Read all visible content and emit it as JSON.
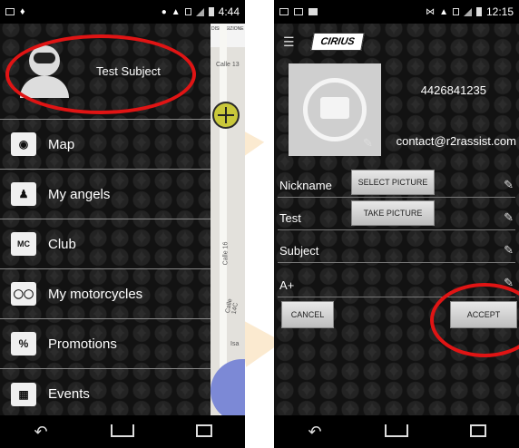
{
  "left_screen": {
    "status_bar": {
      "time": "4:44"
    },
    "profile": {
      "name": "Test Subject"
    },
    "menu": [
      {
        "label": "Map",
        "icon": "map-pin-icon"
      },
      {
        "label": "My angels",
        "icon": "people-icon"
      },
      {
        "label": "Club",
        "icon": "club-house-icon"
      },
      {
        "label": "My motorcycles",
        "icon": "motorcycle-icon"
      },
      {
        "label": "Promotions",
        "icon": "price-tag-icon"
      },
      {
        "label": "Events",
        "icon": "calendar-icon"
      }
    ],
    "map": {
      "top_text": "DISPOSIZIONE",
      "labels": [
        "Calle 13",
        "Calle 16",
        "Calle 14C",
        "Isa"
      ]
    }
  },
  "right_screen": {
    "status_bar": {
      "time": "12:15"
    },
    "logo_text": "CIRIUS",
    "phone": "4426841235",
    "email": "contact@r2rassist.com",
    "fields": {
      "nickname": "Nickname",
      "first_name": "Test",
      "last_name": "Subject",
      "blood_type": "A+"
    },
    "buttons": {
      "select_picture": "SELECT PICTURE",
      "take_picture": "TAKE PICTURE",
      "cancel": "CANCEL",
      "accept": "ACCEPT"
    }
  },
  "colors": {
    "highlight_ellipse": "#e01414",
    "background": "#1c1c1c",
    "watermark": "#eba028"
  }
}
